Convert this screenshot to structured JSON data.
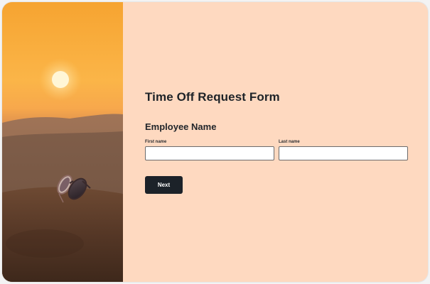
{
  "form": {
    "title": "Time Off Request Form",
    "section_title": "Employee Name",
    "first_name": {
      "label": "First name",
      "value": "",
      "placeholder": ""
    },
    "last_name": {
      "label": "Last name",
      "value": "",
      "placeholder": ""
    },
    "next_label": "Next"
  },
  "colors": {
    "page_background": "#fed9c0",
    "button_background": "#1c2229",
    "button_text": "#ffffff",
    "heading_text": "#1e2328"
  },
  "image": {
    "subject": "desert-sunset-with-sunglasses"
  }
}
